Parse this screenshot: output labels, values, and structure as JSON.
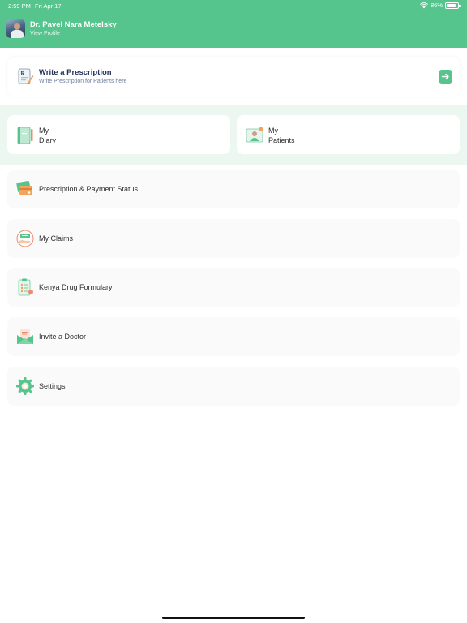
{
  "status_bar": {
    "time": "2:59 PM",
    "date": "Fri Apr 17",
    "battery": "86%",
    "battery_level": 0.86
  },
  "profile": {
    "name": "Dr. Pavel Nara Metelsky",
    "view_link": "View Profile"
  },
  "write_prescription": {
    "title": "Write a Prescription",
    "subtitle": "Write Prescription for Patients here",
    "action_icon": "arrow-right-icon"
  },
  "tiles": {
    "diary": {
      "line1": "My",
      "line2": "Diary",
      "icon": "diary-icon"
    },
    "patients": {
      "line1": "My",
      "line2": "Patients",
      "icon": "patients-icon"
    }
  },
  "menu": [
    {
      "label": "Prescription & Payment Status",
      "icon": "payment-status-icon"
    },
    {
      "label": "My Claims",
      "icon": "claims-icon"
    },
    {
      "label": "Kenya Drug Formulary",
      "icon": "formulary-icon"
    },
    {
      "label": "Invite a Doctor",
      "icon": "invite-icon"
    },
    {
      "label": "Settings",
      "icon": "settings-icon"
    }
  ],
  "colors": {
    "brand_green": "#55c48d",
    "band_bg": "#edf7f1",
    "card_bg": "#fafafa",
    "title_navy": "#24325c"
  }
}
